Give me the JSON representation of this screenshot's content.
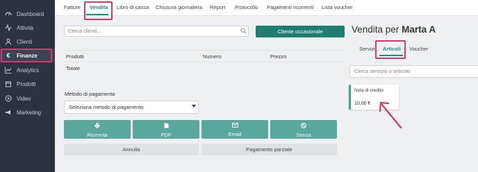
{
  "sidebar": {
    "items": [
      {
        "label": "Dashboard",
        "icon": "speedometer-icon"
      },
      {
        "label": "Attività",
        "icon": "activity-icon"
      },
      {
        "label": "Clienti",
        "icon": "person-icon"
      },
      {
        "label": "Finanze",
        "icon": "euro-icon",
        "active": true
      },
      {
        "label": "Analytics",
        "icon": "chart-line-icon"
      },
      {
        "label": "Prodotti",
        "icon": "box-icon"
      },
      {
        "label": "Video",
        "icon": "play-circle-icon"
      },
      {
        "label": "Marketing",
        "icon": "megaphone-icon"
      }
    ]
  },
  "topnav": {
    "tabs": [
      {
        "label": "Fatture"
      },
      {
        "label": "Vendita",
        "active": true
      },
      {
        "label": "Libro di cassa"
      },
      {
        "label": "Chiusura giornaliera"
      },
      {
        "label": "Report"
      },
      {
        "label": "Protocollo"
      },
      {
        "label": "Pagamenti ricorrenti"
      },
      {
        "label": "Lista voucher"
      }
    ]
  },
  "left": {
    "search_placeholder": "Cerca clienti...",
    "occasional_button": "Cliente occasionale",
    "table": {
      "headers": [
        "Prodotti",
        "Numero",
        "Prezzo"
      ],
      "total_label": "Totale"
    },
    "payment": {
      "label": "Metodo di pagamento",
      "selected": "Seleziona metodo di pagamento"
    },
    "actions": [
      {
        "label": "Ricevuta",
        "icon": "printer-icon"
      },
      {
        "label": "PDF",
        "icon": "document-icon"
      },
      {
        "label": "Email",
        "icon": "envelope-icon"
      },
      {
        "label": "Senza",
        "icon": "ban-icon"
      }
    ],
    "cancel_button": "Annulla",
    "partial_button": "Pagamento parziale"
  },
  "right": {
    "title_prefix": "Vendita per",
    "client_name": "Marta A",
    "tabs": [
      {
        "label": "Servizi"
      },
      {
        "label": "Articoli",
        "active": true
      },
      {
        "label": "Voucher"
      }
    ],
    "search_placeholder": "Cerca servizio o articolo",
    "card": {
      "title": "Nota di credito",
      "price": "10,00 €"
    }
  },
  "colors": {
    "accent": "#1f8f7d",
    "highlight": "#d5386a",
    "sidebar_bg": "#2b3340",
    "action_button": "#5aa89c"
  }
}
